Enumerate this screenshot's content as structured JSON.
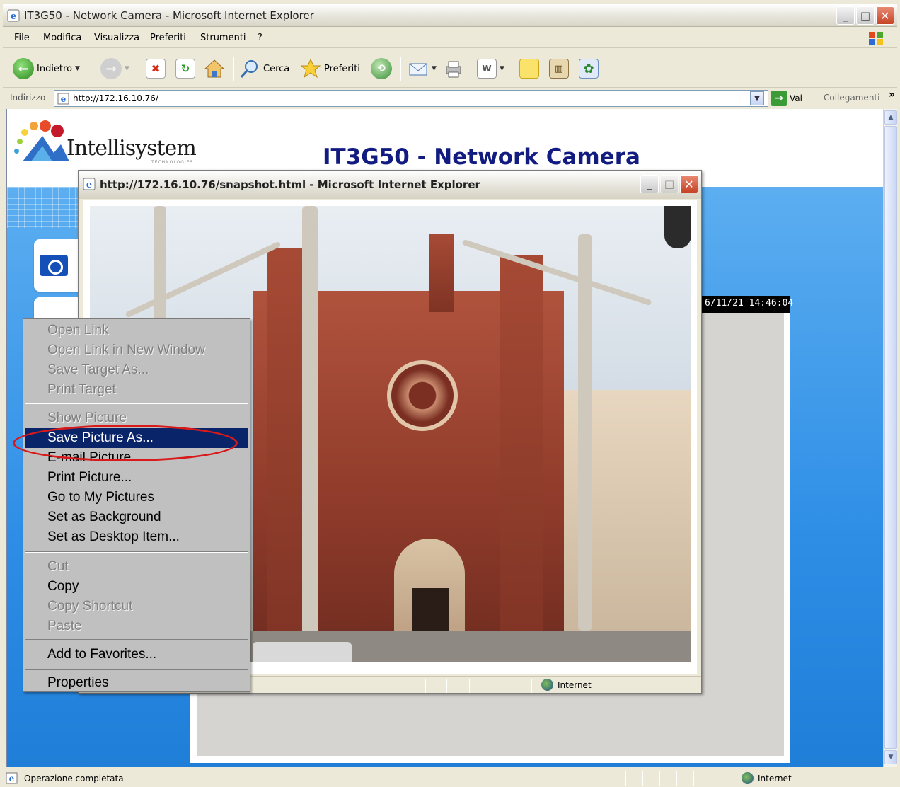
{
  "window": {
    "title": "IT3G50 - Network Camera - Microsoft Internet Explorer"
  },
  "menubar": {
    "items": [
      "File",
      "Modifica",
      "Visualizza",
      "Preferiti",
      "Strumenti",
      "?"
    ]
  },
  "toolbar": {
    "back_label": "Indietro",
    "search_label": "Cerca",
    "favorites_label": "Preferiti"
  },
  "address": {
    "label": "Indirizzo",
    "url": "http://172.16.10.76/",
    "go_label": "Vai",
    "links_label": "Collegamenti"
  },
  "page": {
    "logo_text": "Intellisystem",
    "logo_sub": "TECHNOLOGIES",
    "title": "IT3G50 - Network Camera",
    "timestamp": "6/11/21 14:46:04"
  },
  "popup": {
    "title": "http://172.16.10.76/snapshot.html - Microsoft Internet Explorer",
    "zone": "Internet"
  },
  "context_menu": {
    "items": [
      {
        "label": "Open Link",
        "enabled": false
      },
      {
        "label": "Open Link in New Window",
        "enabled": false
      },
      {
        "label": "Save Target As...",
        "enabled": false
      },
      {
        "label": "Print Target",
        "enabled": false
      },
      {
        "label": "Show Picture",
        "enabled": false
      },
      {
        "label": "Save Picture As...",
        "enabled": true,
        "selected": true
      },
      {
        "label": "E-mail Picture...",
        "enabled": true
      },
      {
        "label": "Print Picture...",
        "enabled": true
      },
      {
        "label": "Go to My Pictures",
        "enabled": true
      },
      {
        "label": "Set as Background",
        "enabled": true
      },
      {
        "label": "Set as Desktop Item...",
        "enabled": true
      },
      {
        "label": "Cut",
        "enabled": false
      },
      {
        "label": "Copy",
        "enabled": true
      },
      {
        "label": "Copy Shortcut",
        "enabled": false
      },
      {
        "label": "Paste",
        "enabled": false
      },
      {
        "label": "Add to Favorites...",
        "enabled": true
      },
      {
        "label": "Properties",
        "enabled": true
      }
    ]
  },
  "statusbar": {
    "text": "Operazione completata",
    "zone": "Internet"
  },
  "colors": {
    "title_blue": "#121c80",
    "menu_selection": "#0a246a",
    "highlight_ring": "#d81a1a",
    "page_blue": "#2e8ee6"
  }
}
